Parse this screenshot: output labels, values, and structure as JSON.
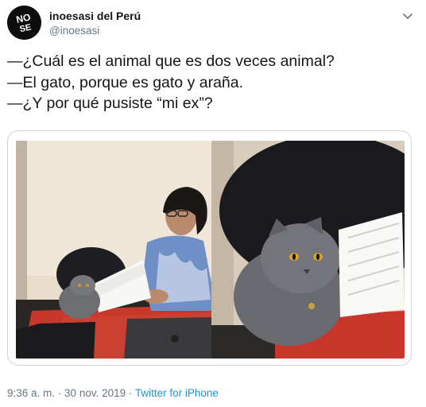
{
  "tweet": {
    "display_name": "inoesasi del Perú",
    "handle": "@inoesasi",
    "avatar_text": "NO SE",
    "lines": [
      "—¿Cuál es el animal que es dos veces animal?",
      "—El gato, porque es gato y araña.",
      "—¿Y por qué pusiste “mi ex”?"
    ],
    "media": [
      {
        "description": "woman reading papers with gray cat"
      },
      {
        "description": "gray cat looking at papers"
      }
    ],
    "footer": {
      "time": "9:36 a. m.",
      "separator": " · ",
      "date": "30 nov. 2019",
      "source": "Twitter for iPhone"
    }
  },
  "colors": {
    "text": "#14171a",
    "secondary": "#657786",
    "link": "#1b95e0",
    "border": "#ccd6dd"
  },
  "icons": {
    "menu": "chevron-down-icon"
  }
}
